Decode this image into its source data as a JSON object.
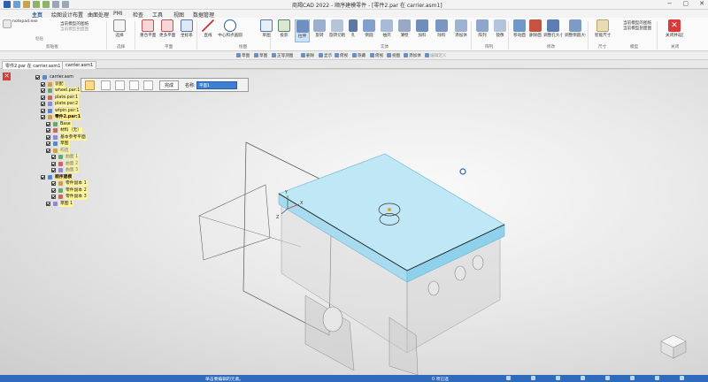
{
  "window": {
    "title": "商羯CAD 2022 - 顺序建模零件 - [零件2.par 在 carrier.asm1]",
    "controls": [
      "−",
      "▢",
      "✕"
    ]
  },
  "ribbon_tabs": [
    "主页",
    "绘图设计布置",
    "曲面处理",
    "PMI",
    "检查",
    "工具",
    "视图",
    "数据管理"
  ],
  "ribbon": {
    "clipboard": {
      "main": "notepad.exe",
      "sub1": "当前模型的图纸",
      "sub2": "当前模型剖面图",
      "paste": "粘贴",
      "group": "剪贴板"
    },
    "select": {
      "label": "选择",
      "group": "选择"
    },
    "plane": {
      "b1": "重合平面",
      "b2": "更多平面",
      "b3": "坐标系",
      "group": "平面"
    },
    "draw": {
      "b1": "直线",
      "b2": "中心和点画圆",
      "group": "绘图"
    },
    "sketch": {
      "b1": "草图",
      "b2": "投影",
      "b3": "拉伸",
      "b4": "旋转",
      "b5": "旋转切削",
      "b6": "孔",
      "b7": "倒圆",
      "b8": "抽壳",
      "b9": "薄壁",
      "b10": "加料",
      "b11": "除料",
      "b12": "添加体",
      "group": "实体"
    },
    "pattern": {
      "b1": "阵列",
      "b2": "镜像",
      "group": "阵列"
    },
    "modify": {
      "b1": "移动面",
      "b2": "删除面",
      "b3": "调整孔大小",
      "b4": "调整倒圆大小",
      "group": "修改"
    },
    "dims": {
      "b1": "智能尺寸",
      "group": "尺寸"
    },
    "model": {
      "b1": "当前模型的图纸",
      "b2": "当前模型剖面图",
      "group": "模型"
    },
    "close": {
      "b1": "关闭并返回",
      "group": "关闭"
    }
  },
  "command_bar": [
    "草图",
    "草图",
    "正等测图",
    "删除",
    "显示",
    "俯视",
    "隐藏",
    "俯视",
    "视图",
    "添加体",
    "编辑定义"
  ],
  "doc_tabs": [
    "零件2.par 在 carrier.asm1",
    "carrier.asm1"
  ],
  "command_panel": {
    "done": "完成",
    "name_label": "名称:",
    "name_value": "平面1"
  },
  "tree": [
    {
      "text": "carrier.asm",
      "style": "plain",
      "indent": 0
    },
    {
      "text": "装配",
      "style": "hl",
      "indent": 1
    },
    {
      "text": "wheel.par:1",
      "style": "hl",
      "indent": 1
    },
    {
      "text": "plate.par:1",
      "style": "hl",
      "indent": 1
    },
    {
      "text": "plate.par:2",
      "style": "hl",
      "indent": 1
    },
    {
      "text": "wtpin.par:1",
      "style": "hl",
      "indent": 1
    },
    {
      "text": "零件2.par:1",
      "style": "hl2",
      "indent": 1
    },
    {
      "text": "Base",
      "style": "hl",
      "indent": 2
    },
    {
      "text": "材料（无）",
      "style": "hl",
      "indent": 2
    },
    {
      "text": "基本参考平面",
      "style": "hl",
      "indent": 2
    },
    {
      "text": "草图",
      "style": "hl",
      "indent": 2
    },
    {
      "text": "构造",
      "style": "dim",
      "indent": 2
    },
    {
      "text": "曲面 1",
      "style": "dim",
      "indent": 3
    },
    {
      "text": "曲面 2",
      "style": "dim",
      "indent": 3
    },
    {
      "text": "曲面 3",
      "style": "dim",
      "indent": 3
    },
    {
      "text": "顺序建模",
      "style": "hl2",
      "indent": 1
    },
    {
      "text": "零件副本 1",
      "style": "hl",
      "indent": 3
    },
    {
      "text": "零件副本 2",
      "style": "hl",
      "indent": 3
    },
    {
      "text": "零件副本 3",
      "style": "hl",
      "indent": 3
    },
    {
      "text": "草图 1",
      "style": "hl",
      "indent": 2
    }
  ],
  "statusbar": {
    "prompt": "单击要编辑的元素。",
    "selection": "0 项已选"
  },
  "axis_labels": {
    "x": "X",
    "y": "Y",
    "z": "Z"
  },
  "colors": {
    "part_top": "#bfe7f6",
    "part_side": "#8fd1ea",
    "statusbar": "#2f6bbd",
    "highlight": "#fff59a"
  }
}
